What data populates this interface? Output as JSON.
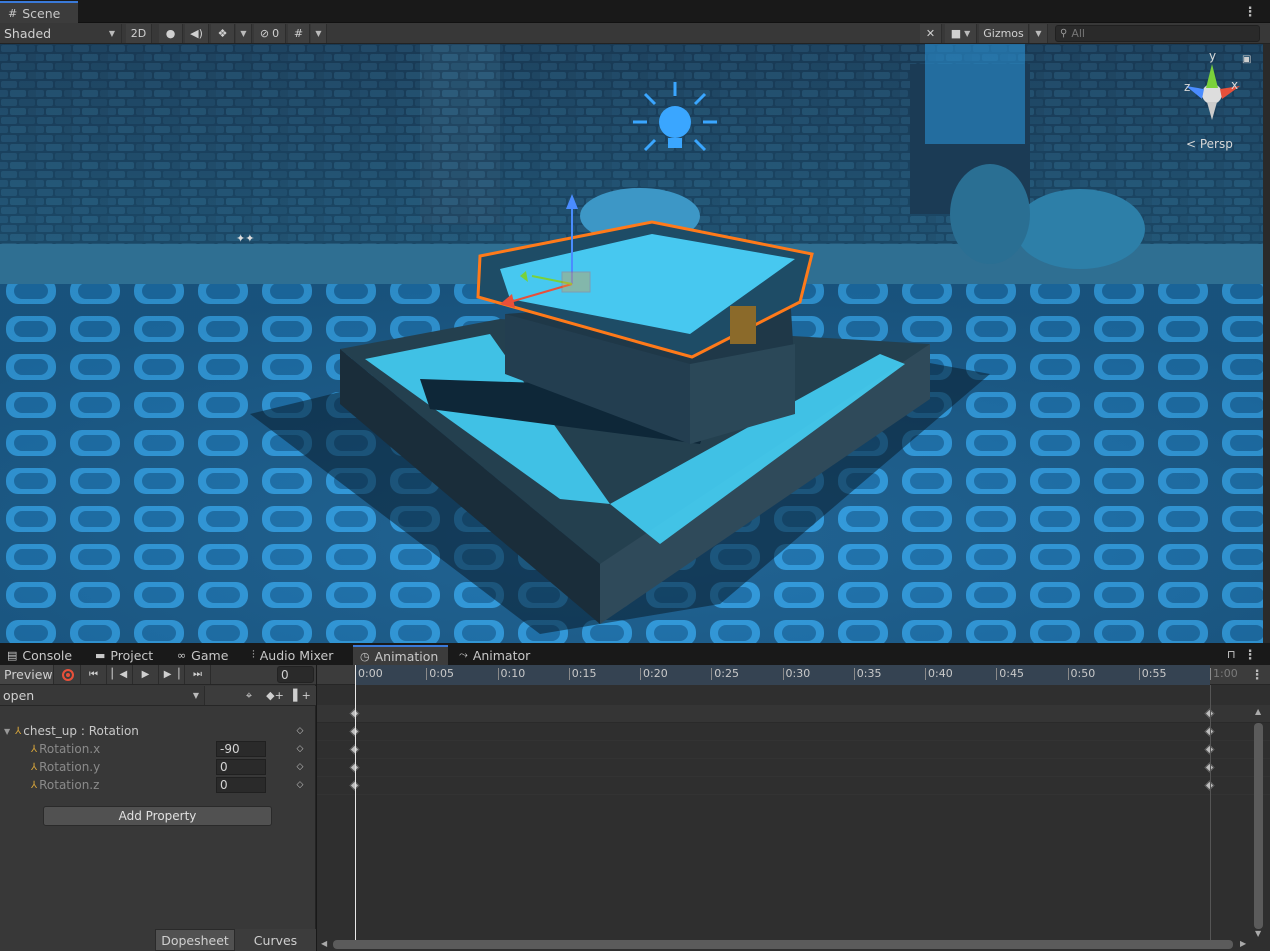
{
  "scene": {
    "tab_label": "Scene",
    "shading_mode": "Shaded",
    "mode_2d": "2D",
    "hidden_count": "0",
    "gizmos_label": "Gizmos",
    "search_placeholder": "All",
    "axis_y": "y",
    "axis_x": "x",
    "axis_z": "z",
    "projection": "< Persp"
  },
  "bottom_tabs": [
    {
      "label": "Console",
      "icon": "console-icon"
    },
    {
      "label": "Project",
      "icon": "folder-icon"
    },
    {
      "label": "Game",
      "icon": "gamepad-icon"
    },
    {
      "label": "Audio Mixer",
      "icon": "mixer-icon"
    },
    {
      "label": "Animation",
      "icon": "clock-icon"
    },
    {
      "label": "Animator",
      "icon": "animator-icon"
    }
  ],
  "animation": {
    "preview_label": "Preview",
    "frame_value": "0",
    "clip_name": "open",
    "property_group": "chest_up : Rotation",
    "properties": [
      {
        "label": "Rotation.x",
        "value": "-90"
      },
      {
        "label": "Rotation.y",
        "value": "0"
      },
      {
        "label": "Rotation.z",
        "value": "0"
      }
    ],
    "add_property_label": "Add Property",
    "dopesheet_label": "Dopesheet",
    "curves_label": "Curves",
    "timeline_ticks": [
      "0:00",
      "0:05",
      "0:10",
      "0:15",
      "0:20",
      "0:25",
      "0:30",
      "0:35",
      "0:40",
      "0:45",
      "0:50",
      "0:55",
      "1:00"
    ],
    "keyframe_times": [
      "0:00",
      "1:00"
    ]
  },
  "colors": {
    "accent_tab": "#3a7ad9",
    "selection_outline": "#ff7a1a",
    "record_red": "#e8503a",
    "keyframe": "#bdbdbd"
  }
}
